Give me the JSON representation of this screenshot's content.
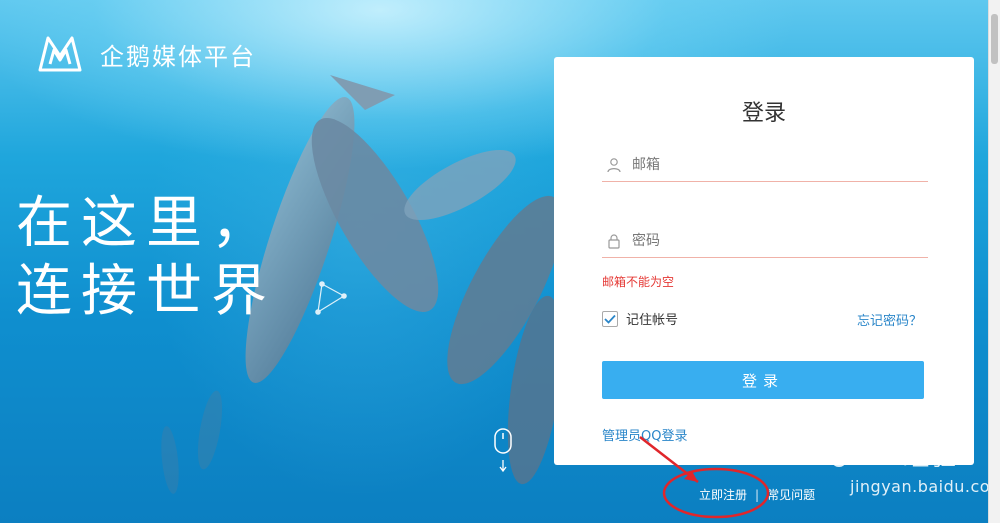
{
  "brand": {
    "name": "企鹅媒体平台"
  },
  "slogan": {
    "line1": "在这里，",
    "line2": "连接世界"
  },
  "login": {
    "title": "登录",
    "email_placeholder": "邮箱",
    "email_value": "",
    "password_placeholder": "密码",
    "password_value": "",
    "error": "邮箱不能为空",
    "remember_label": "记住帐号",
    "remember_checked": true,
    "forgot_label": "忘记密码？",
    "submit_label": "登录",
    "admin_qq_label": "管理员QQ登录"
  },
  "footer": {
    "register_label": "立即注册",
    "separator": "|",
    "faq_label": "常见问题"
  },
  "watermark": {
    "brand": "Bai",
    "brand_tail": "du",
    "cn": "经验",
    "url": "jingyan.baidu.com"
  },
  "colors": {
    "accent": "#38aef0",
    "link": "#2a86c9",
    "error": "#e53935",
    "annotation": "#e0262b"
  },
  "icons": {
    "logo": "m-logo-icon",
    "user": "user-icon",
    "lock": "lock-icon",
    "check": "check-icon",
    "mouse": "mouse-scroll-icon"
  }
}
